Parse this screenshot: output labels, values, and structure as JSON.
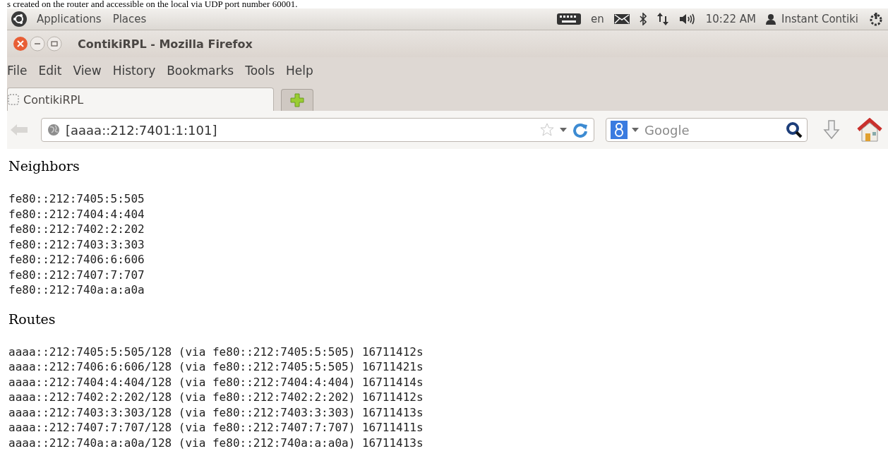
{
  "document_text_above": "s created on the router and accessible on the local via UDP port number 60001.",
  "top_panel": {
    "menus": [
      "Applications",
      "Places"
    ],
    "keyboard_layout": "en",
    "time": "10:22 AM",
    "user": "Instant Contiki"
  },
  "window": {
    "title": "ContikiRPL - Mozilla Firefox"
  },
  "menu_bar": [
    "File",
    "Edit",
    "View",
    "History",
    "Bookmarks",
    "Tools",
    "Help"
  ],
  "tabs": [
    {
      "label": "ContikiRPL",
      "selected": true
    }
  ],
  "address_bar": {
    "value": "[aaaa::212:7401:1:101]"
  },
  "search": {
    "placeholder": "Google"
  },
  "page": {
    "sections": [
      {
        "heading": "Neighbors",
        "lines": [
          "fe80::212:7405:5:505",
          "fe80::212:7404:4:404",
          "fe80::212:7402:2:202",
          "fe80::212:7403:3:303",
          "fe80::212:7406:6:606",
          "fe80::212:7407:7:707",
          "fe80::212:740a:a:a0a"
        ]
      },
      {
        "heading": "Routes",
        "lines": [
          "aaaa::212:7405:5:505/128 (via fe80::212:7405:5:505) 16711412s",
          "aaaa::212:7406:6:606/128 (via fe80::212:7405:5:505) 16711421s",
          "aaaa::212:7404:4:404/128 (via fe80::212:7404:4:404) 16711414s",
          "aaaa::212:7402:2:202/128 (via fe80::212:7402:2:202) 16711412s",
          "aaaa::212:7403:3:303/128 (via fe80::212:7403:3:303) 16711413s",
          "aaaa::212:7407:7:707/128 (via fe80::212:7407:7:707) 16711411s",
          "aaaa::212:740a:a:a0a/128 (via fe80::212:740a:a:a0a) 16711413s"
        ]
      }
    ]
  }
}
